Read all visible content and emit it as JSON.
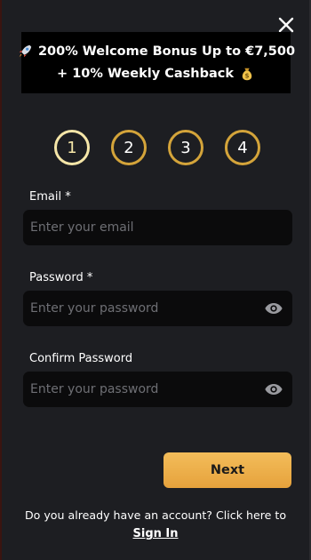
{
  "banner": {
    "line1": "200% Welcome Bonus Up to €7,500",
    "line2": "+ 10% Weekly Cashback",
    "line1_icon": "rocket-icon",
    "line2_icon": "money-bag-icon"
  },
  "steps": [
    "1",
    "2",
    "3",
    "4"
  ],
  "active_step": 1,
  "fields": {
    "email": {
      "label": "Email *",
      "placeholder": "Enter your email",
      "value": ""
    },
    "password": {
      "label": "Password *",
      "placeholder": "Enter your password",
      "value": "",
      "icon": "eye-icon"
    },
    "confirm_password": {
      "label": "Confirm Password",
      "placeholder": "Enter your password",
      "value": "",
      "icon": "eye-icon"
    }
  },
  "buttons": {
    "next": "Next",
    "close_icon": "close-icon"
  },
  "footer": {
    "account_text": "Do you already have an account? Click here to",
    "signin_label": "Sign In"
  },
  "colors": {
    "accent_gold": "#e6a23c",
    "step_border": "#d4a43a",
    "active_step": "#f5e6a8",
    "modal_bg": "#1d1e22",
    "input_bg": "#0b0b0c"
  }
}
